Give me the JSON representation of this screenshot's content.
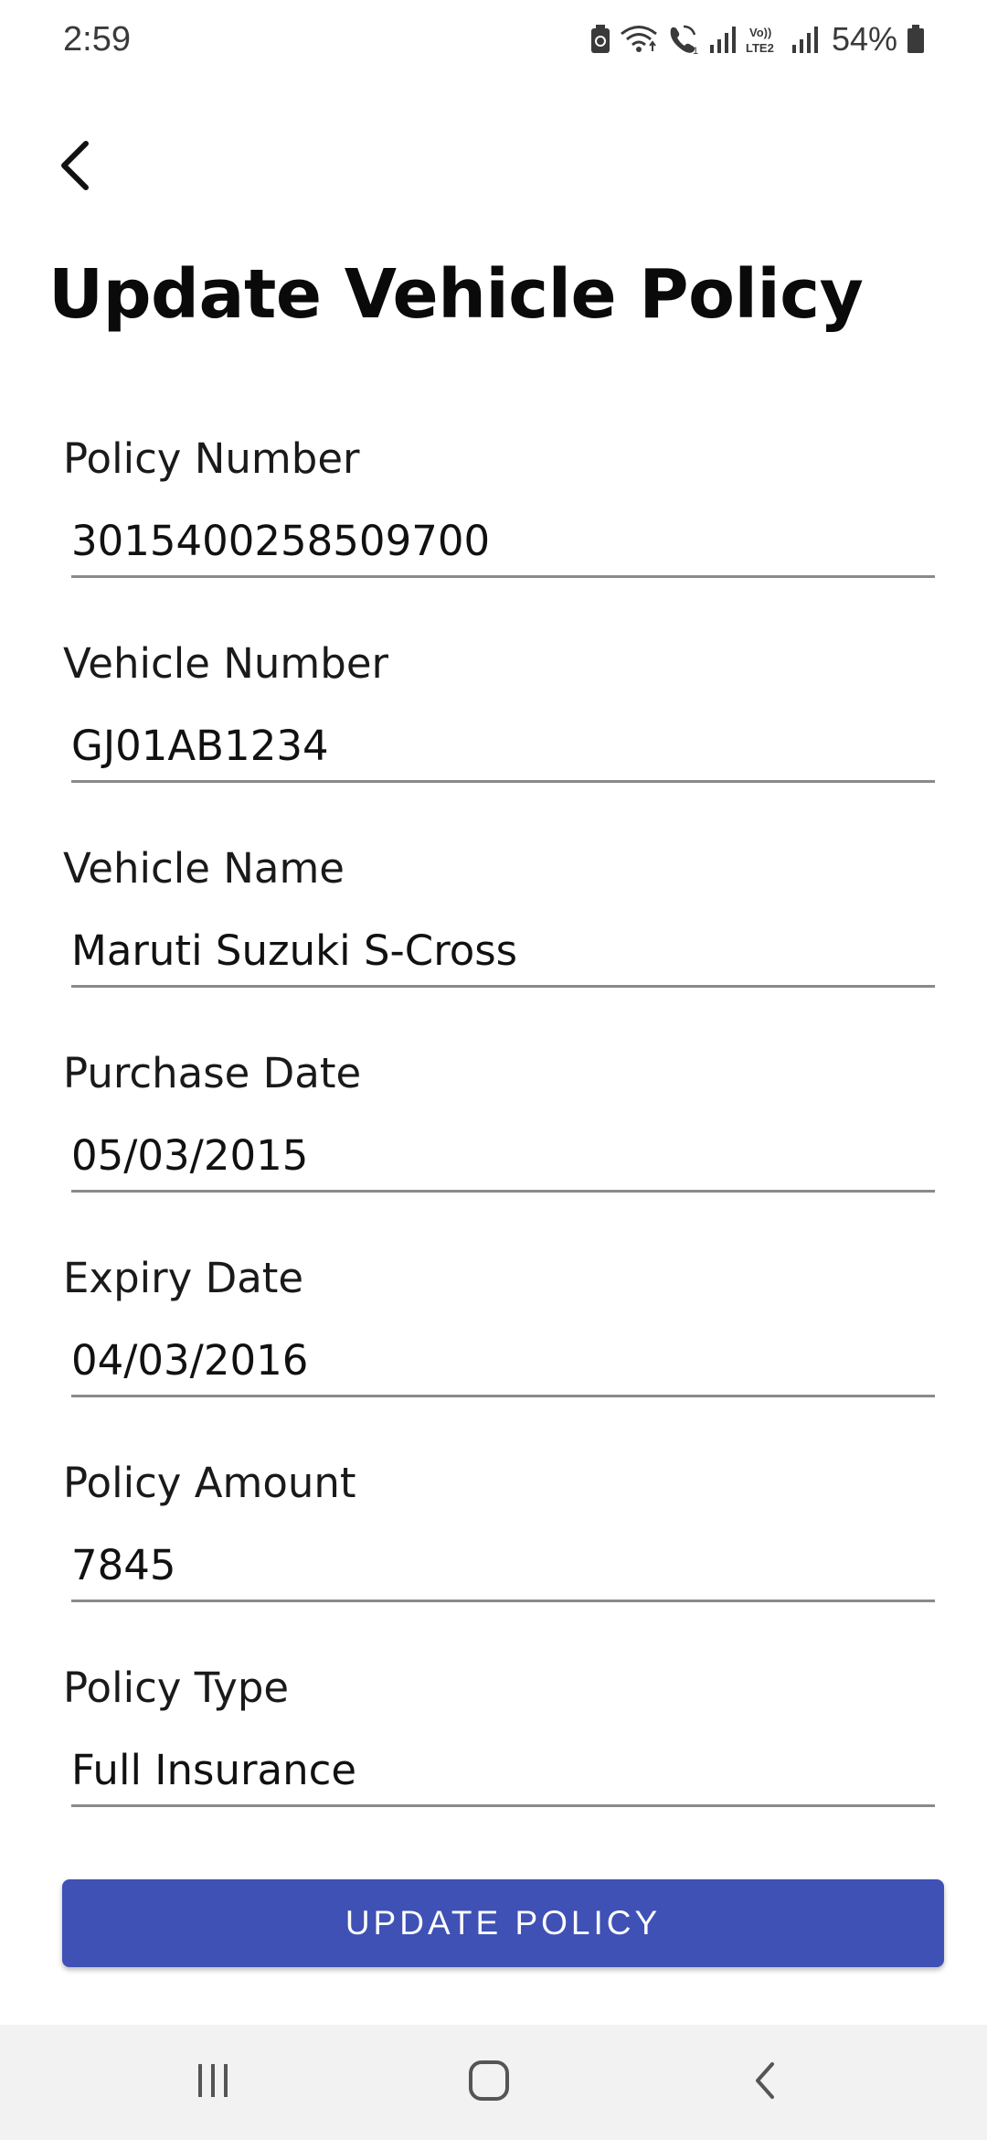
{
  "status_bar": {
    "time": "2:59",
    "battery": "54%",
    "icons": [
      "battery-saver-icon",
      "wifi-icon",
      "wifi-calling-icon",
      "signal-icon",
      "volte-lte2-icon",
      "signal-icon",
      "battery-icon"
    ]
  },
  "header": {
    "back_icon": "chevron-left-icon",
    "title": "Update Vehicle Policy"
  },
  "form": {
    "fields": [
      {
        "label": "Policy Number",
        "value": "3015400258509700"
      },
      {
        "label": "Vehicle Number",
        "value": "GJ01AB1234"
      },
      {
        "label": "Vehicle Name",
        "value": "Maruti Suzuki S-Cross"
      },
      {
        "label": "Purchase Date",
        "value": "05/03/2015"
      },
      {
        "label": "Expiry Date",
        "value": "04/03/2016"
      },
      {
        "label": "Policy Amount",
        "value": "7845"
      },
      {
        "label": "Policy Type",
        "value": "Full Insurance"
      }
    ],
    "submit_label": "UPDATE POLICY"
  },
  "nav_bar": {
    "icons": [
      "recent-apps-icon",
      "home-icon",
      "back-icon"
    ]
  },
  "colors": {
    "accent": "#3f51b5",
    "underline": "#8a8a8a",
    "nav_background": "#f2f2f2"
  }
}
